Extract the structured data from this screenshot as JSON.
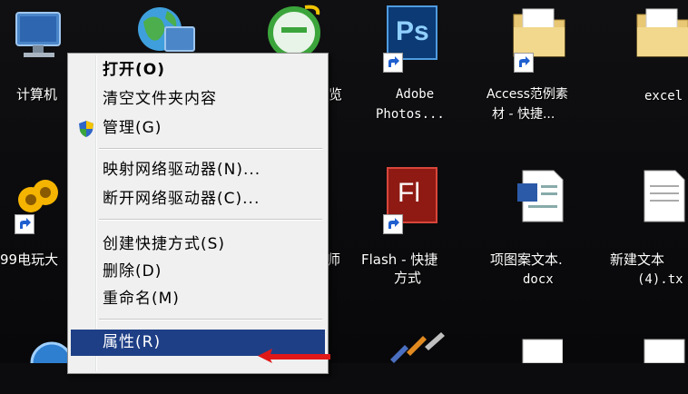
{
  "desktop": {
    "icons": [
      {
        "label": "计算机"
      },
      {
        "label": ""
      },
      {
        "label": "览"
      },
      {
        "label_line1": "Adobe",
        "label_line2": "Photos..."
      },
      {
        "label_line1": "Access范例素",
        "label_line2": "材 - 快捷..."
      },
      {
        "label_line1": "excel"
      },
      {
        "label": "99电玩大"
      },
      {
        "label": "师"
      },
      {
        "label_line1": "Flash - 快捷",
        "label_line2": "方式"
      },
      {
        "label_line1": "项图案文本.",
        "label_line2": "docx"
      },
      {
        "label_line1": "新建文本",
        "label_line2": "(4).tx"
      }
    ],
    "ps_text": "Ps",
    "fl_text": "Fl"
  },
  "context_menu": {
    "items": [
      {
        "label": "打开(O)"
      },
      {
        "label": "清空文件夹内容"
      },
      {
        "label": "管理(G)"
      },
      {
        "label": "映射网络驱动器(N)..."
      },
      {
        "label": "断开网络驱动器(C)..."
      },
      {
        "label": "创建快捷方式(S)"
      },
      {
        "label": "删除(D)"
      },
      {
        "label": "重命名(M)"
      },
      {
        "label": "属性(R)"
      }
    ],
    "selected_item": "属性(R)"
  },
  "colors": {
    "menu_bg": "#f0f0f0",
    "selection": "#1e3f86",
    "desktop_bg": "#0c0c0e",
    "ps_blue": "#0b3a74",
    "fl_red": "#8f1a14",
    "folder_yellow": "#e8c874"
  }
}
